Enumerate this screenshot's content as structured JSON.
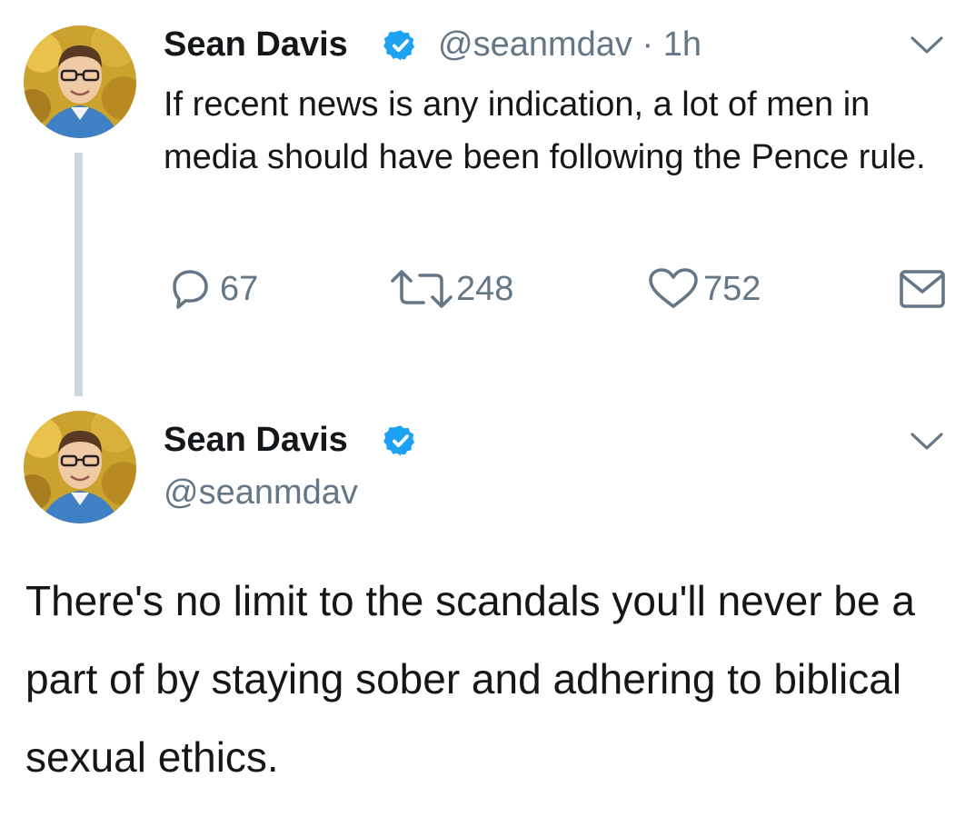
{
  "tweet1": {
    "author_name": "Sean Davis",
    "handle": "@seanmdav",
    "separator": "·",
    "time": "1h",
    "text": "If recent news is any indication, a lot of men in media should have been following the Pence rule.",
    "actions": {
      "reply_count": "67",
      "retweet_count": "248",
      "like_count": "752"
    }
  },
  "tweet2": {
    "author_name": "Sean Davis",
    "handle": "@seanmdav",
    "text": "There's no limit to the scandals you'll never be a part of by staying sober and adhering to biblical sexual ethics."
  },
  "colors": {
    "verified_blue": "#1da1f2",
    "secondary_text": "#657786",
    "thread_line": "#ccd6dd",
    "primary_text": "#14171a"
  },
  "icons": {
    "verified": "verified-badge-icon",
    "menu": "chevron-down-icon",
    "reply": "reply-icon",
    "retweet": "retweet-icon",
    "like": "heart-icon",
    "dm": "envelope-icon"
  }
}
